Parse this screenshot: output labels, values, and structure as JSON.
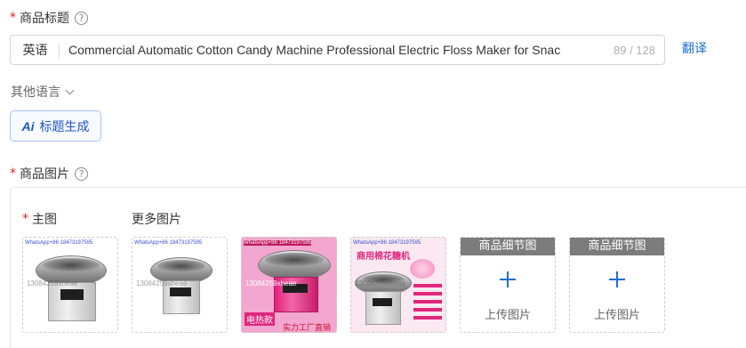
{
  "title_field": {
    "required_mark": "*",
    "label": "商品标题",
    "help_icon": "?",
    "language_prefix": "英语",
    "value": "Commercial Automatic Cotton Candy Machine Professional Electric Floss Maker for Snac",
    "counter": "89 / 128",
    "translate_label": "翻译"
  },
  "other_languages": {
    "label": "其他语言"
  },
  "ai_title_button": {
    "icon_text": "Ai",
    "label": "标题生成"
  },
  "images_field": {
    "required_mark": "*",
    "label": "商品图片",
    "help_icon": "?",
    "main_image_label": "主图",
    "more_images_label": "更多图片",
    "thumbnails": [
      {
        "watermark": "WhatsApp+86 18473197595",
        "overlay": "13084259xheae"
      },
      {
        "watermark": "WhatsApp+86 18473197595",
        "overlay": "13084259xheae"
      },
      {
        "watermark": "WhatsApp+86 18473197595",
        "overlay": "13084259xheae",
        "badge": "电热款",
        "footer": "实力工厂直销"
      },
      {
        "watermark": "WhatsApp+86 18473197595",
        "overlay": "13084259xheae",
        "headline": "商用棉花糖机"
      }
    ],
    "detail_slots": [
      {
        "header": "商品细节图",
        "upload_label": "上传图片"
      },
      {
        "header": "商品细节图",
        "upload_label": "上传图片"
      }
    ]
  },
  "colors": {
    "accent": "#1c6fd6",
    "required": "#e02020",
    "ai_button": "#1f55c9"
  },
  "icons": [
    "help-icon",
    "chevron-down-icon",
    "ai-icon",
    "plus-icon"
  ]
}
